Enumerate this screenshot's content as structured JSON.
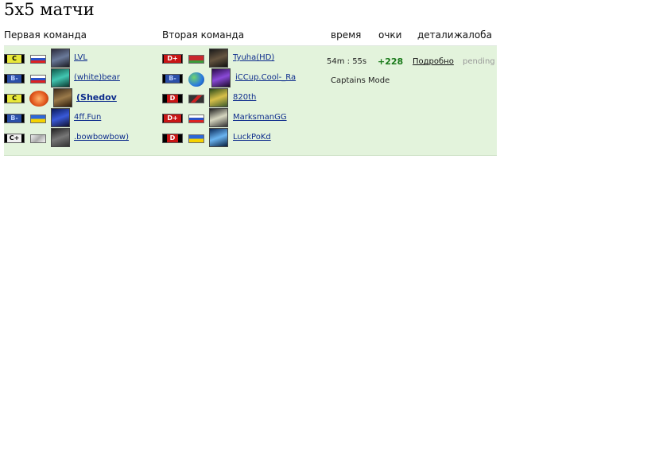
{
  "page": {
    "title": "5x5 матчи"
  },
  "columns": {
    "team1": "Первая команда",
    "team2": "Вторая команда",
    "time": "время",
    "points": "очки",
    "details": "детали",
    "complaint": "жалоба"
  },
  "match": {
    "time": "54m : 55s",
    "points": "+228",
    "details_link": "Подробно",
    "complaint_status": "pending",
    "mode": "Captains Mode",
    "team1": [
      {
        "rank": "C",
        "flag": "ru",
        "name": "LVL"
      },
      {
        "rank": "B-",
        "flag": "ru",
        "name": "(white)bear"
      },
      {
        "rank": "C",
        "flag": "clan",
        "name": "(Shedov"
      },
      {
        "rank": "B-",
        "flag": "ua",
        "name": "4ff.Fun"
      },
      {
        "rank": "C+",
        "flag": "none",
        "name": ".bowbowbow)"
      }
    ],
    "team2": [
      {
        "rank": "D+",
        "flag": "by",
        "name": "Tyuha(HD)"
      },
      {
        "rank": "B-",
        "flag": "globe",
        "name": "iCCup.Cool-_Ra"
      },
      {
        "rank": "D",
        "flag": "unk",
        "name": "820th"
      },
      {
        "rank": "D+",
        "flag": "ru",
        "name": "MarksmanGG"
      },
      {
        "rank": "D",
        "flag": "ua",
        "name": "LuckPoKd"
      }
    ]
  }
}
